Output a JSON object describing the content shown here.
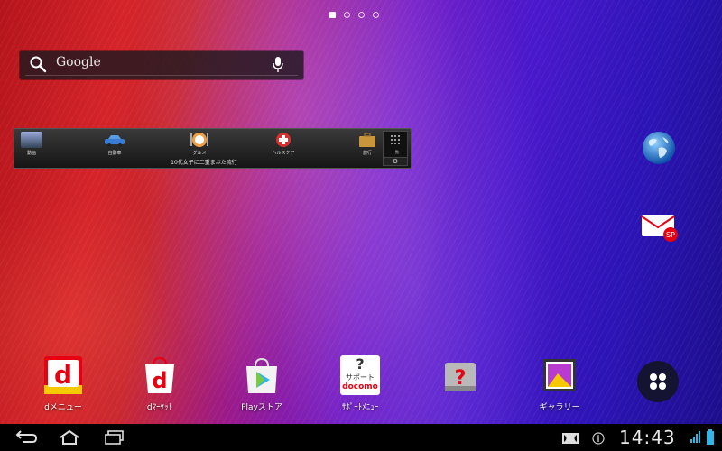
{
  "search": {
    "label": "Google"
  },
  "widget": {
    "items": [
      {
        "label": "動画"
      },
      {
        "label": "自動車"
      },
      {
        "label": "グルメ"
      },
      {
        "label": "ヘルスケア"
      },
      {
        "label": "旅行"
      }
    ],
    "grid_label": "一覧",
    "headline": "10代女子に二重まぶた流行"
  },
  "dock": [
    {
      "label": "dメニュー",
      "icon": "dmenu-icon"
    },
    {
      "label": "dﾏｰｹｯﾄ",
      "icon": "dmarket-icon"
    },
    {
      "label": "Playストア",
      "icon": "play-store-icon"
    },
    {
      "label": "ｻﾎﾟｰﾄﾒﾆｭｰ",
      "icon": "support-menu-icon"
    },
    {
      "label": "",
      "icon": "docomo-wifi-icon"
    },
    {
      "label": "ギャラリー",
      "icon": "gallery-icon"
    }
  ],
  "support_icon": {
    "line1": "サポート",
    "line2": "docomo"
  },
  "status": {
    "time": "14:43"
  },
  "colors": {
    "docomo_red": "#e60012",
    "android_blue": "#33b5e5"
  }
}
